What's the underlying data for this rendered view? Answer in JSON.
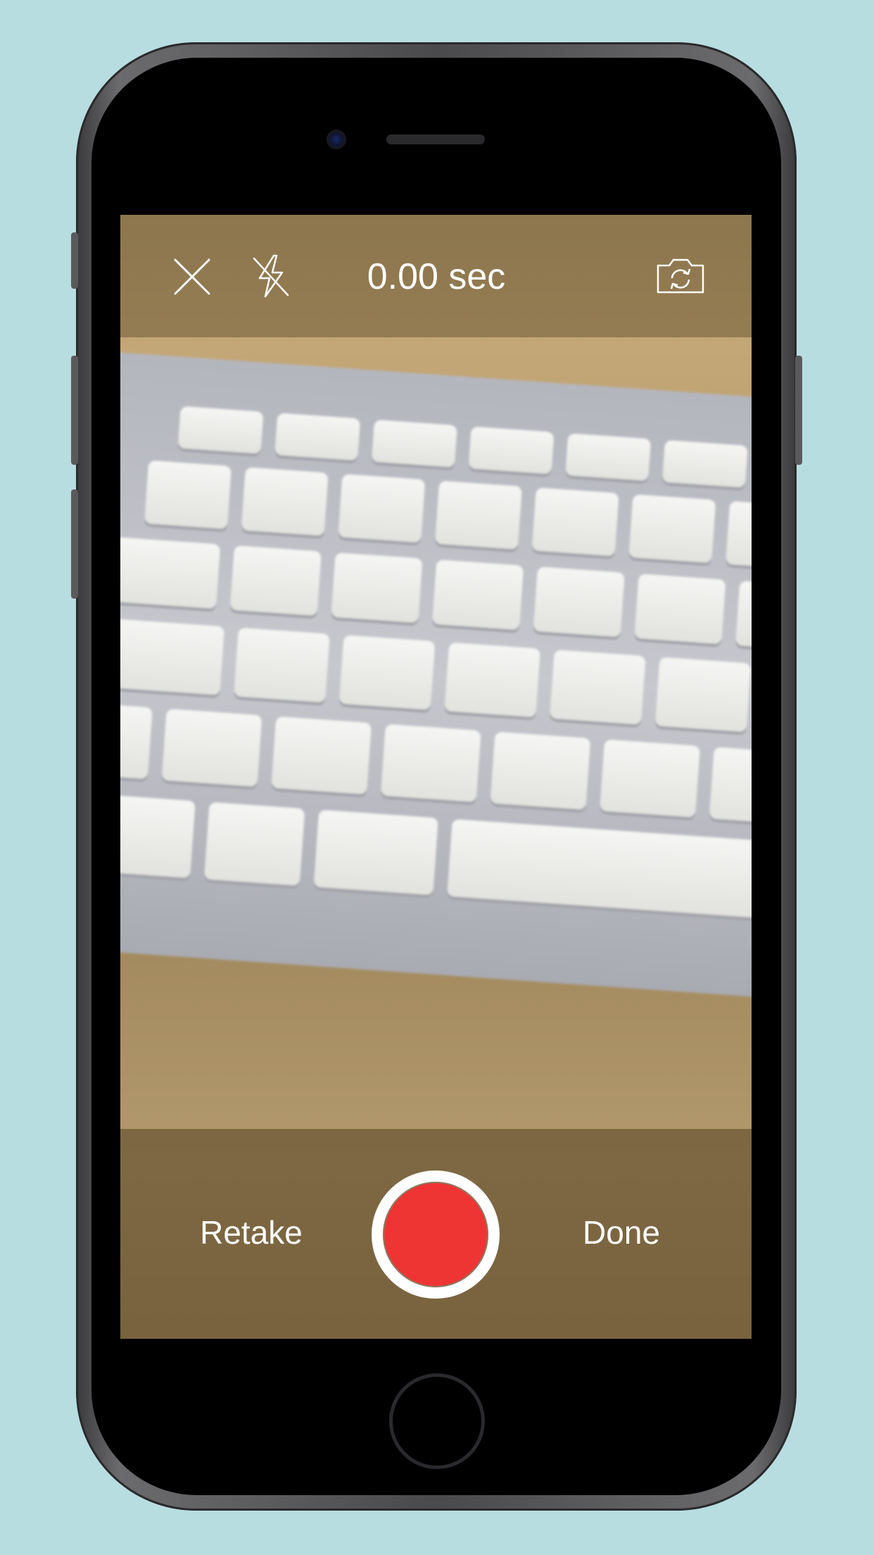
{
  "camera": {
    "timer_text": "0.00 sec",
    "close_icon": "close-icon",
    "flash_icon": "flash-off-icon",
    "switch_icon": "switch-camera-icon"
  },
  "controls": {
    "retake_label": "Retake",
    "done_label": "Done",
    "record_color": "#ef3434"
  },
  "background_color": "#b8dde0"
}
